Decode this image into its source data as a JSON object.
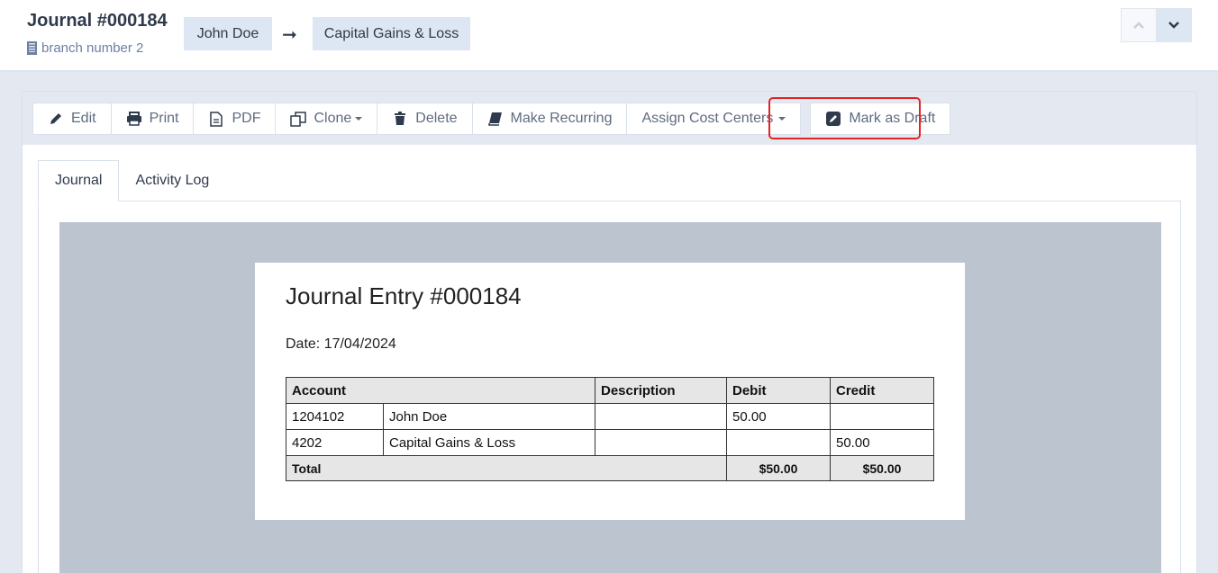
{
  "header": {
    "title": "Journal #000184",
    "branch": "branch number 2",
    "from_account": "John Doe",
    "arrow": "➞",
    "to_account": "Capital Gains & Loss"
  },
  "toolbar": {
    "edit": "Edit",
    "print": "Print",
    "pdf": "PDF",
    "clone": "Clone",
    "delete": "Delete",
    "make_recurring": "Make Recurring",
    "assign_cost_centers": "Assign Cost Centers",
    "mark_as_draft": "Mark as Draft"
  },
  "tabs": {
    "journal": "Journal",
    "activity_log": "Activity Log"
  },
  "document": {
    "title": "Journal Entry #000184",
    "date": "Date: 17/04/2024",
    "columns": {
      "account": "Account",
      "description": "Description",
      "debit": "Debit",
      "credit": "Credit"
    },
    "rows": [
      {
        "code": "1204102",
        "name": "John Doe",
        "description": "",
        "debit": "50.00",
        "credit": ""
      },
      {
        "code": "4202",
        "name": "Capital Gains & Loss",
        "description": "",
        "debit": "",
        "credit": "50.00"
      }
    ],
    "total": {
      "label": "Total",
      "debit": "$50.00",
      "credit": "$50.00"
    }
  }
}
